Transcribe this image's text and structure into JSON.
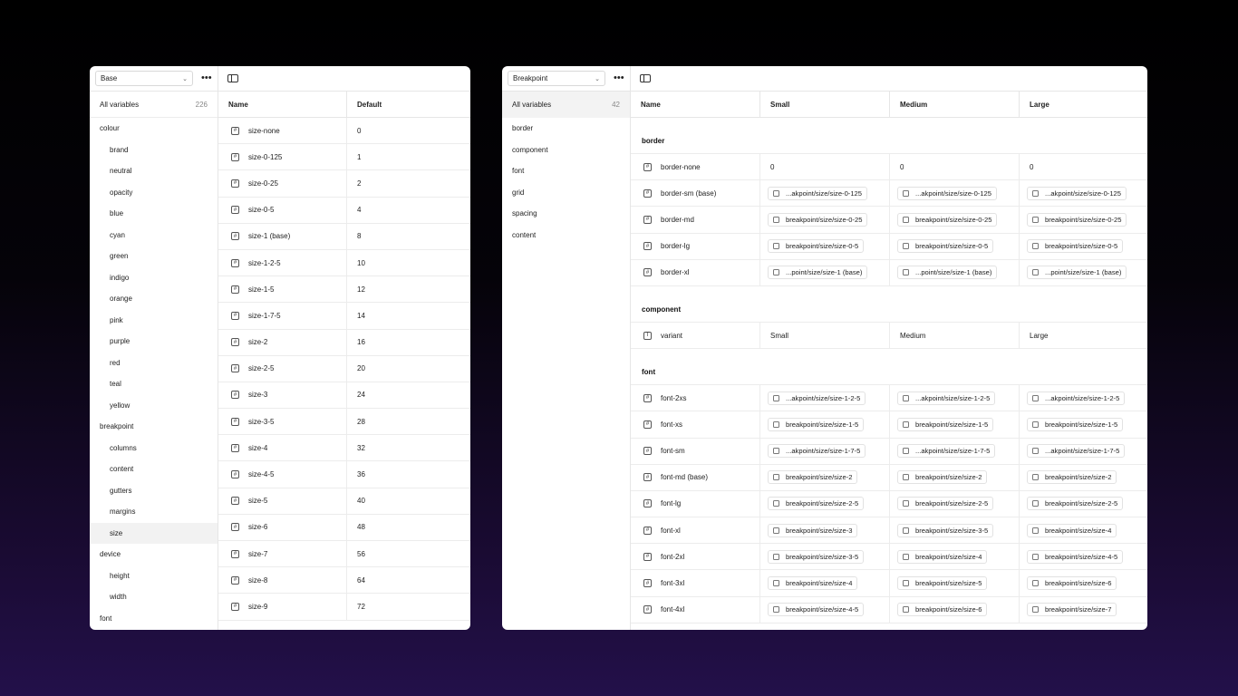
{
  "left_panel": {
    "collection_select": "Base",
    "more_label": "•••",
    "all_variables": {
      "label": "All variables",
      "count": "226"
    },
    "groups": [
      {
        "label": "colour",
        "level": 0
      },
      {
        "label": "brand",
        "level": 1
      },
      {
        "label": "neutral",
        "level": 1
      },
      {
        "label": "opacity",
        "level": 1
      },
      {
        "label": "blue",
        "level": 1
      },
      {
        "label": "cyan",
        "level": 1
      },
      {
        "label": "green",
        "level": 1
      },
      {
        "label": "indigo",
        "level": 1
      },
      {
        "label": "orange",
        "level": 1
      },
      {
        "label": "pink",
        "level": 1
      },
      {
        "label": "purple",
        "level": 1
      },
      {
        "label": "red",
        "level": 1
      },
      {
        "label": "teal",
        "level": 1
      },
      {
        "label": "yellow",
        "level": 1
      },
      {
        "label": "breakpoint",
        "level": 0
      },
      {
        "label": "columns",
        "level": 1
      },
      {
        "label": "content",
        "level": 1
      },
      {
        "label": "gutters",
        "level": 1
      },
      {
        "label": "margins",
        "level": 1
      },
      {
        "label": "size",
        "level": 1,
        "selected": true
      },
      {
        "label": "device",
        "level": 0
      },
      {
        "label": "height",
        "level": 1
      },
      {
        "label": "width",
        "level": 1
      },
      {
        "label": "font",
        "level": 0
      }
    ],
    "columns": [
      "Name",
      "Default"
    ],
    "rows": [
      {
        "name": "size-none",
        "value": "0"
      },
      {
        "name": "size-0-125",
        "value": "1"
      },
      {
        "name": "size-0-25",
        "value": "2"
      },
      {
        "name": "size-0-5",
        "value": "4"
      },
      {
        "name": "size-1 (base)",
        "value": "8"
      },
      {
        "name": "size-1-2-5",
        "value": "10"
      },
      {
        "name": "size-1-5",
        "value": "12"
      },
      {
        "name": "size-1-7-5",
        "value": "14"
      },
      {
        "name": "size-2",
        "value": "16"
      },
      {
        "name": "size-2-5",
        "value": "20"
      },
      {
        "name": "size-3",
        "value": "24"
      },
      {
        "name": "size-3-5",
        "value": "28"
      },
      {
        "name": "size-4",
        "value": "32"
      },
      {
        "name": "size-4-5",
        "value": "36"
      },
      {
        "name": "size-5",
        "value": "40"
      },
      {
        "name": "size-6",
        "value": "48"
      },
      {
        "name": "size-7",
        "value": "56"
      },
      {
        "name": "size-8",
        "value": "64"
      },
      {
        "name": "size-9",
        "value": "72"
      }
    ]
  },
  "right_panel": {
    "collection_select": "Breakpoint",
    "more_label": "•••",
    "all_variables": {
      "label": "All variables",
      "count": "42"
    },
    "groups": [
      "border",
      "component",
      "font",
      "grid",
      "spacing",
      "content"
    ],
    "columns": [
      "Name",
      "Small",
      "Medium",
      "Large"
    ],
    "sections": [
      {
        "title": "border",
        "rows": [
          {
            "name": "border-none",
            "icon": "number",
            "values": [
              {
                "text": "0",
                "alias": false
              },
              {
                "text": "0",
                "alias": false
              },
              {
                "text": "0",
                "alias": false
              }
            ]
          },
          {
            "name": "border-sm (base)",
            "icon": "number",
            "values": [
              {
                "text": "...akpoint/size/size-0-125",
                "alias": true
              },
              {
                "text": "...akpoint/size/size-0-125",
                "alias": true
              },
              {
                "text": "...akpoint/size/size-0-125",
                "alias": true
              }
            ]
          },
          {
            "name": "border-md",
            "icon": "number",
            "values": [
              {
                "text": "breakpoint/size/size-0-25",
                "alias": true
              },
              {
                "text": "breakpoint/size/size-0-25",
                "alias": true
              },
              {
                "text": "breakpoint/size/size-0-25",
                "alias": true
              }
            ]
          },
          {
            "name": "border-lg",
            "icon": "number",
            "values": [
              {
                "text": "breakpoint/size/size-0-5",
                "alias": true
              },
              {
                "text": "breakpoint/size/size-0-5",
                "alias": true
              },
              {
                "text": "breakpoint/size/size-0-5",
                "alias": true
              }
            ]
          },
          {
            "name": "border-xl",
            "icon": "number",
            "values": [
              {
                "text": "...point/size/size-1 (base)",
                "alias": true
              },
              {
                "text": "...point/size/size-1 (base)",
                "alias": true
              },
              {
                "text": "...point/size/size-1 (base)",
                "alias": true
              }
            ]
          }
        ]
      },
      {
        "title": "component",
        "rows": [
          {
            "name": "variant",
            "icon": "text",
            "values": [
              {
                "text": "Small",
                "alias": false
              },
              {
                "text": "Medium",
                "alias": false
              },
              {
                "text": "Large",
                "alias": false
              }
            ]
          }
        ]
      },
      {
        "title": "font",
        "rows": [
          {
            "name": "font-2xs",
            "icon": "number",
            "values": [
              {
                "text": "...akpoint/size/size-1-2-5",
                "alias": true
              },
              {
                "text": "...akpoint/size/size-1-2-5",
                "alias": true
              },
              {
                "text": "...akpoint/size/size-1-2-5",
                "alias": true
              }
            ]
          },
          {
            "name": "font-xs",
            "icon": "number",
            "values": [
              {
                "text": "breakpoint/size/size-1-5",
                "alias": true
              },
              {
                "text": "breakpoint/size/size-1-5",
                "alias": true
              },
              {
                "text": "breakpoint/size/size-1-5",
                "alias": true
              }
            ]
          },
          {
            "name": "font-sm",
            "icon": "number",
            "values": [
              {
                "text": "...akpoint/size/size-1-7-5",
                "alias": true
              },
              {
                "text": "...akpoint/size/size-1-7-5",
                "alias": true
              },
              {
                "text": "...akpoint/size/size-1-7-5",
                "alias": true
              }
            ]
          },
          {
            "name": "font-md (base)",
            "icon": "number",
            "values": [
              {
                "text": "breakpoint/size/size-2",
                "alias": true
              },
              {
                "text": "breakpoint/size/size-2",
                "alias": true
              },
              {
                "text": "breakpoint/size/size-2",
                "alias": true
              }
            ]
          },
          {
            "name": "font-lg",
            "icon": "number",
            "values": [
              {
                "text": "breakpoint/size/size-2-5",
                "alias": true
              },
              {
                "text": "breakpoint/size/size-2-5",
                "alias": true
              },
              {
                "text": "breakpoint/size/size-2-5",
                "alias": true
              }
            ]
          },
          {
            "name": "font-xl",
            "icon": "number",
            "values": [
              {
                "text": "breakpoint/size/size-3",
                "alias": true
              },
              {
                "text": "breakpoint/size/size-3-5",
                "alias": true
              },
              {
                "text": "breakpoint/size/size-4",
                "alias": true
              }
            ]
          },
          {
            "name": "font-2xl",
            "icon": "number",
            "values": [
              {
                "text": "breakpoint/size/size-3-5",
                "alias": true
              },
              {
                "text": "breakpoint/size/size-4",
                "alias": true
              },
              {
                "text": "breakpoint/size/size-4-5",
                "alias": true
              }
            ]
          },
          {
            "name": "font-3xl",
            "icon": "number",
            "values": [
              {
                "text": "breakpoint/size/size-4",
                "alias": true
              },
              {
                "text": "breakpoint/size/size-5",
                "alias": true
              },
              {
                "text": "breakpoint/size/size-6",
                "alias": true
              }
            ]
          },
          {
            "name": "font-4xl",
            "icon": "number",
            "values": [
              {
                "text": "breakpoint/size/size-4-5",
                "alias": true
              },
              {
                "text": "breakpoint/size/size-6",
                "alias": true
              },
              {
                "text": "breakpoint/size/size-7",
                "alias": true
              }
            ]
          }
        ]
      }
    ]
  }
}
